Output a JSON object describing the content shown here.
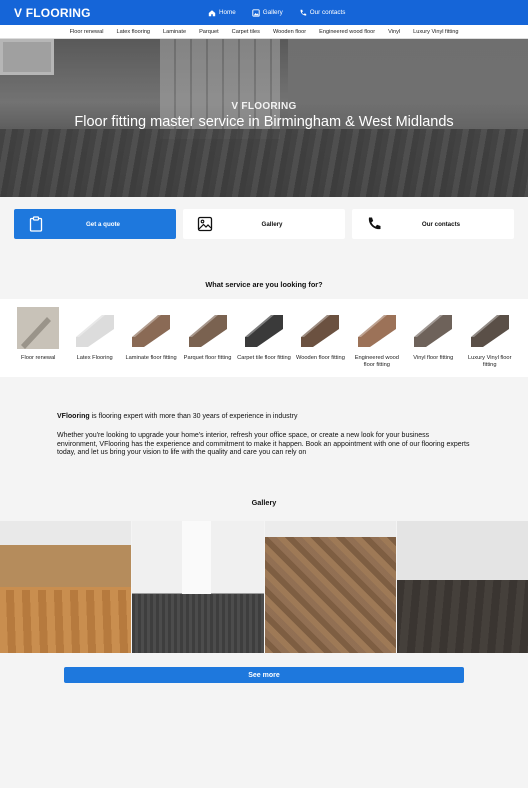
{
  "header": {
    "logo": "V FLOORING",
    "nav": [
      {
        "label": "Home",
        "icon": "home-icon"
      },
      {
        "label": "Gallery",
        "icon": "image-icon"
      },
      {
        "label": "Our contacts",
        "icon": "phone-icon"
      }
    ]
  },
  "subnav": [
    "Floor renewal",
    "Latex flooring",
    "Laminate",
    "Parquet",
    "Carpet tiles",
    "Wooden floor",
    "Engineered wood floor",
    "Vinyl",
    "Luxury Vinyl fitting"
  ],
  "hero": {
    "subtitle": "V FLOORING",
    "title": "Floor fitting master service in Birmingham & West Midlands"
  },
  "actions": [
    {
      "label": "Get a quote",
      "icon": "clipboard-icon"
    },
    {
      "label": "Gallery",
      "icon": "image-icon"
    },
    {
      "label": "Our contacts",
      "icon": "phone-icon"
    }
  ],
  "services": {
    "title": "What service are you looking for?",
    "items": [
      {
        "label": "Floor renewal",
        "color": "#c8c2b8"
      },
      {
        "label": "Latex Flooring",
        "color": "#dcdcdc"
      },
      {
        "label": "Laminate floor fitting",
        "color": "#8a6a55"
      },
      {
        "label": "Parquet floor fitting",
        "color": "#7a6250"
      },
      {
        "label": "Carpet tile floor fitting",
        "color": "#3a3a3a"
      },
      {
        "label": "Wooden floor fitting",
        "color": "#6b5140"
      },
      {
        "label": "Engineered wood floor fitting",
        "color": "#9c7258"
      },
      {
        "label": "Vinyl floor fitting",
        "color": "#6e625a"
      },
      {
        "label": "Luxury Vinyl floor fitting",
        "color": "#5a4f47"
      }
    ]
  },
  "about": {
    "brand": "VFlooring",
    "line1": " is flooring expert with more than 30 years of experience in industry",
    "paragraph": "Whether you're looking to upgrade your home's interior, refresh your office space, or create a new look for your business environment, VFlooring has the experience and commitment to make it happen. Book an appointment with one of our flooring experts today, and let us bring your vision to life with the quality and care you can rely on"
  },
  "gallery": {
    "title": "Gallery",
    "button": "See more"
  },
  "colors": {
    "brand": "#1565d8",
    "accent": "#1e78dd"
  }
}
